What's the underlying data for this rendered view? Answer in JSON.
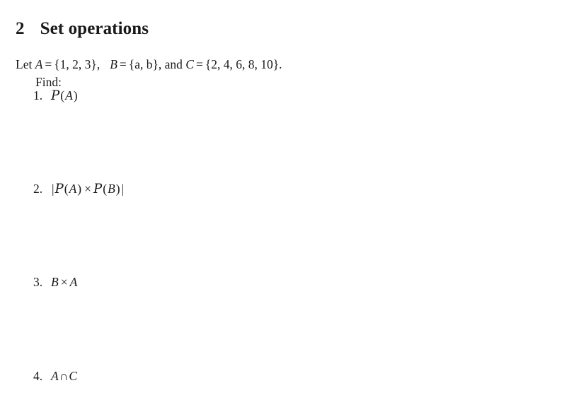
{
  "document": {
    "section": {
      "number": "2",
      "title": "Set operations"
    },
    "intro": {
      "lead": "Let",
      "set_a_name": "A",
      "equals": "=",
      "set_a_value": "{1, 2, 3}",
      "comma_1": ",",
      "set_b_name": "B",
      "set_b_value": "{a, b}",
      "conjunction": ", and",
      "set_c_name": "C",
      "set_c_value": "{2, 4, 6, 8, 10}",
      "period": ".",
      "find_label": "Find:",
      "full_text": "Let A = {1, 2, 3},   B = {a, b}, and C = {2, 4, 6, 8, 10}."
    },
    "problems": [
      {
        "marker": "1.",
        "expression": "P(A)",
        "power_set_symbol": "P",
        "operand": "A",
        "open_paren": "(",
        "close_paren": ")"
      },
      {
        "marker": "2.",
        "expression": "|P(A) x P(B)|",
        "left_bar": "|",
        "right_bar": "|",
        "power_set_symbol": "P",
        "operand_1": "A",
        "operand_2": "B",
        "operator": "×",
        "open_paren": "(",
        "close_paren": ")"
      },
      {
        "marker": "3.",
        "expression": "B × A",
        "operand_1": "B",
        "operator": "×",
        "operand_2": "A"
      },
      {
        "marker": "4.",
        "expression": "A ∩ C",
        "operand_1": "A",
        "operator": "∩",
        "operand_2": "C"
      }
    ]
  },
  "colors": {
    "page_background": "#ffffff",
    "text": "#1a1a1a"
  }
}
